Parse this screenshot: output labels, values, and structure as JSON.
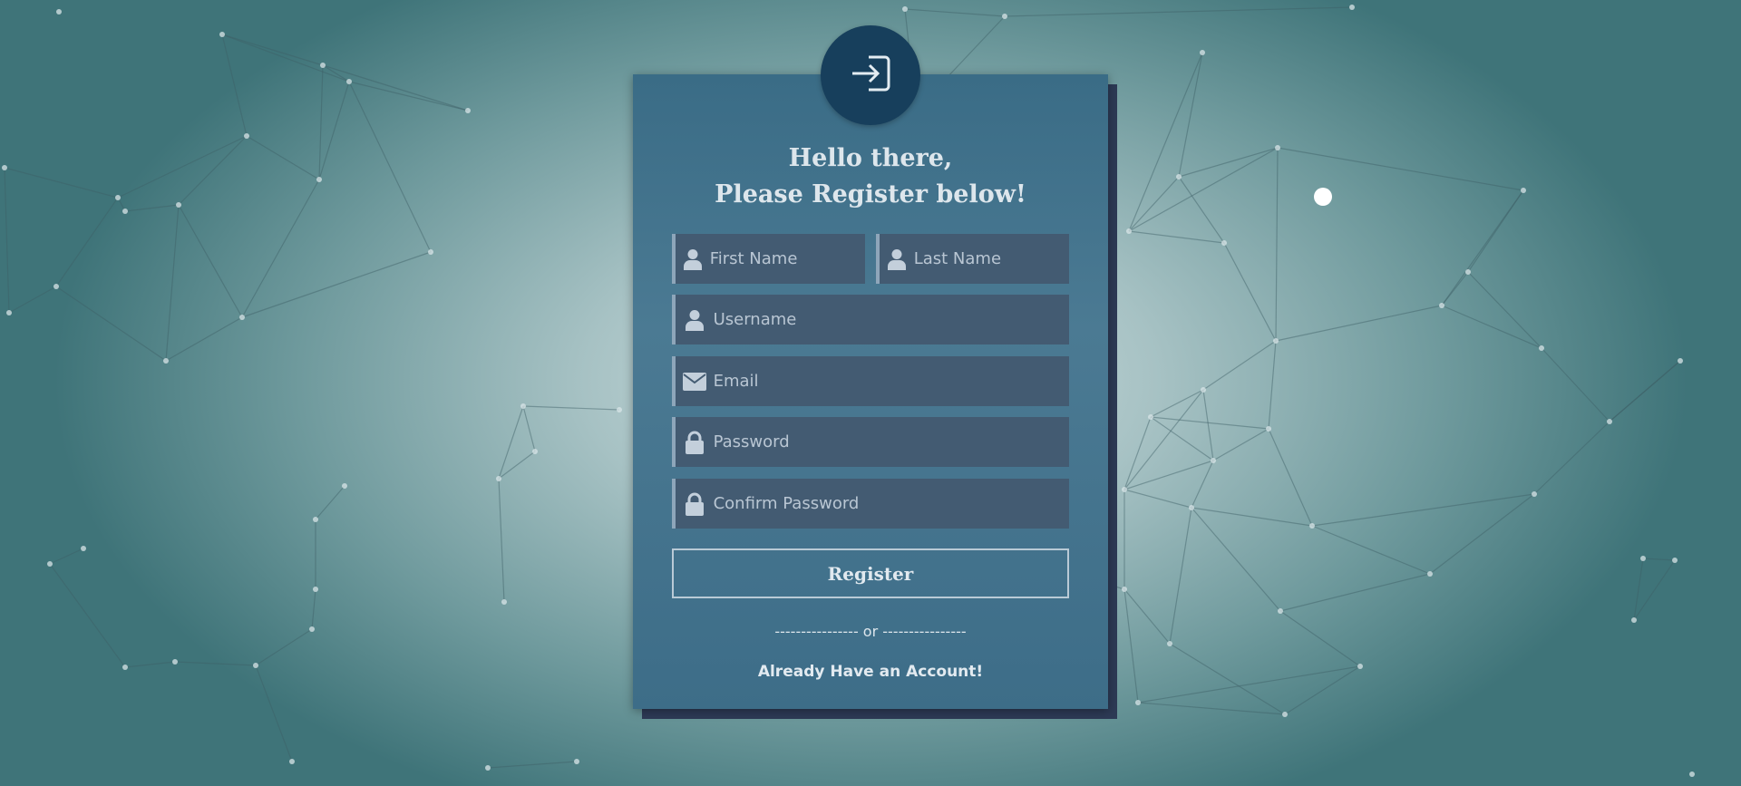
{
  "heading": {
    "line1": "Hello there,",
    "line2": "Please Register below!"
  },
  "form": {
    "first_name_placeholder": "First Name",
    "last_name_placeholder": "Last Name",
    "username_placeholder": "Username",
    "email_placeholder": "Email",
    "password_placeholder": "Password",
    "confirm_password_placeholder": "Confirm Password",
    "register_label": "Register"
  },
  "divider_text": "---------------- or ----------------",
  "signin_link": "Already Have an Account!",
  "icons": {
    "badge": "login-icon",
    "first_name": "user-icon",
    "last_name": "user-icon",
    "username": "user-icon",
    "email": "envelope-icon",
    "password": "lock-icon",
    "confirm_password": "lock-icon"
  },
  "colors": {
    "card": "#3d6d88",
    "field": "#435b72",
    "badge": "#173f5c",
    "text": "#dde6ec"
  }
}
